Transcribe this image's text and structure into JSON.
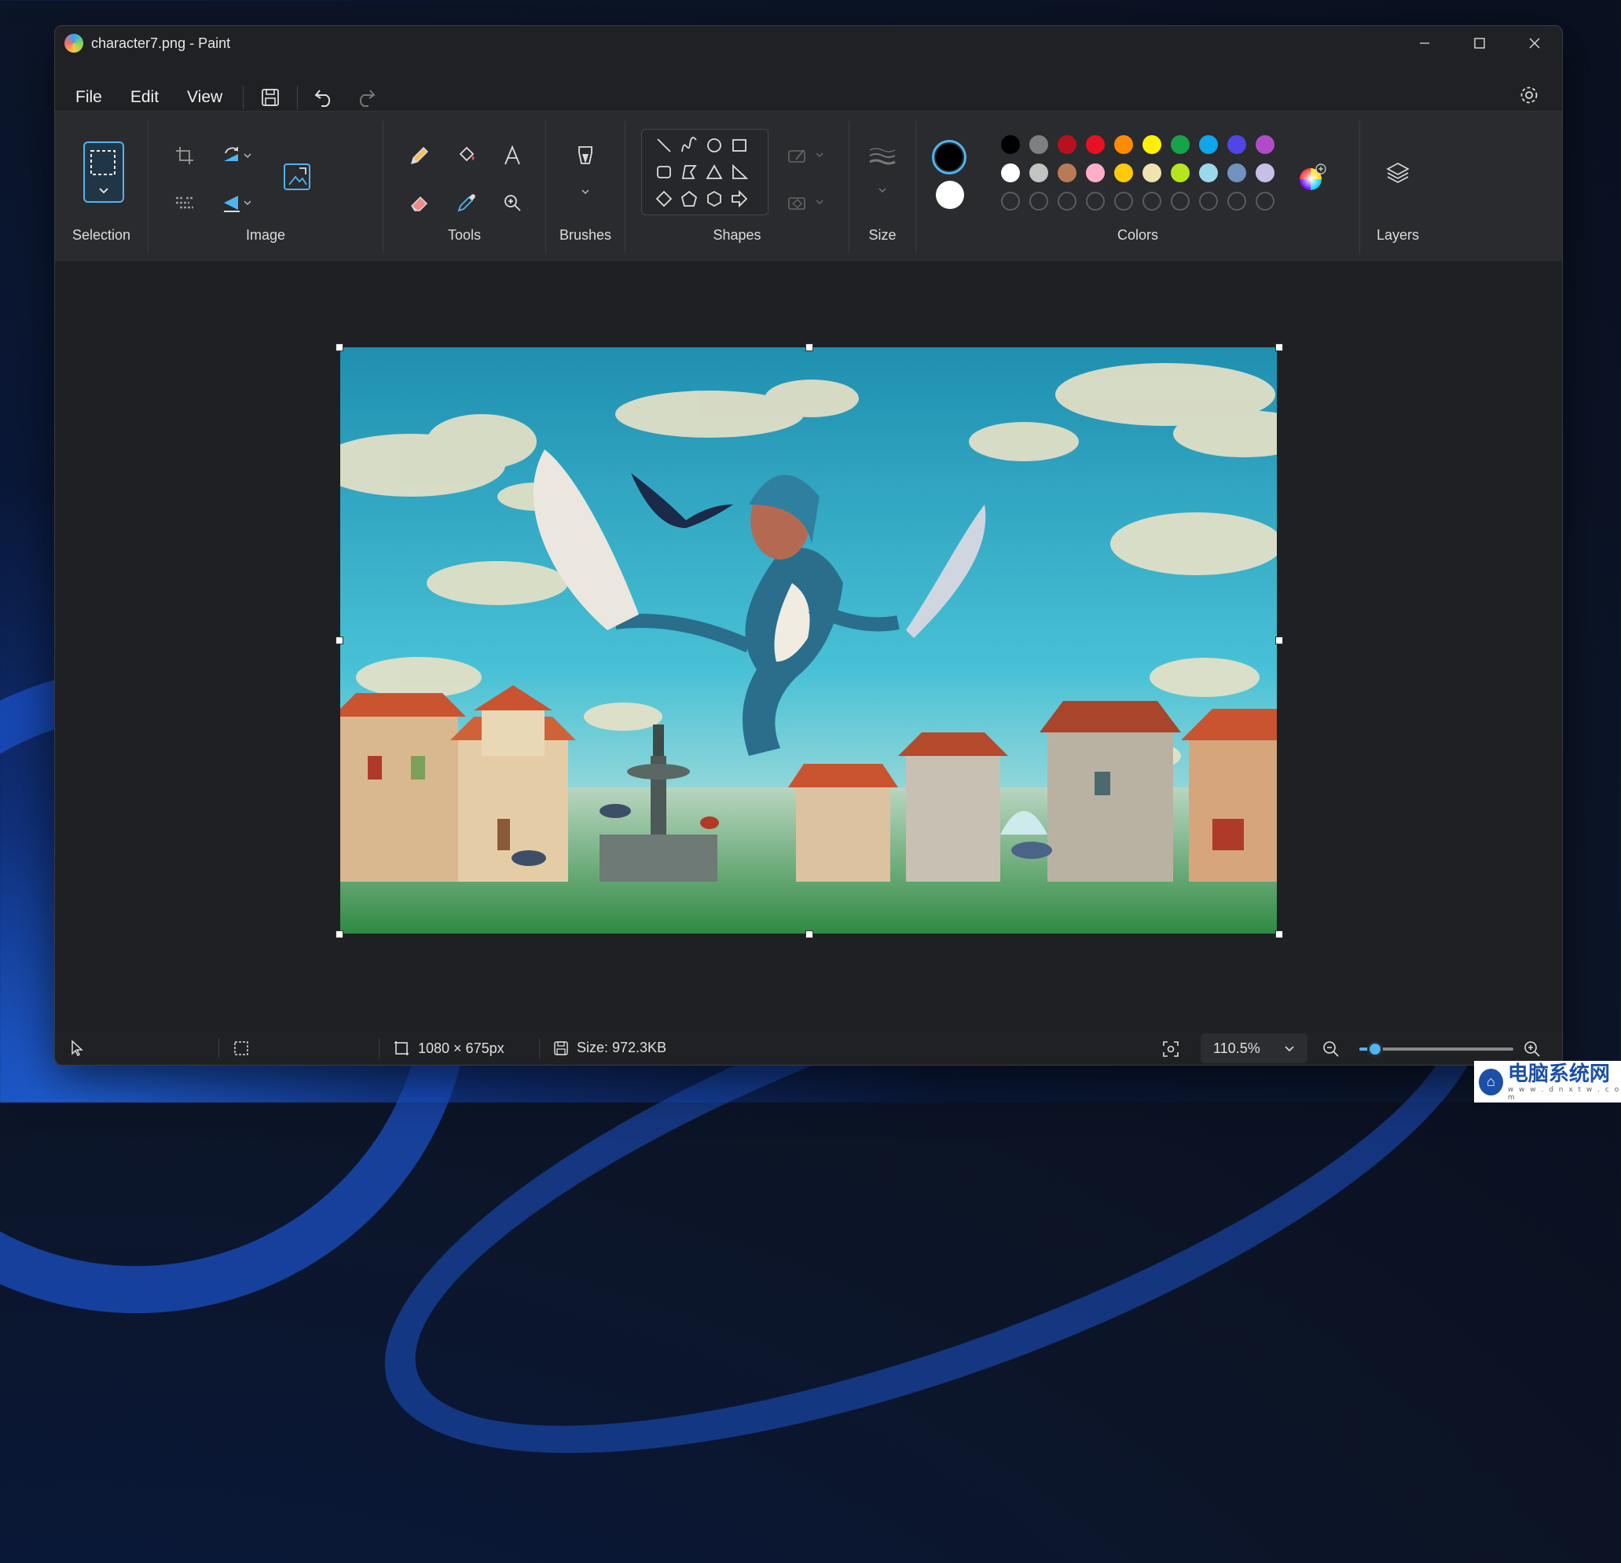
{
  "window": {
    "title": "character7.png - Paint"
  },
  "menu": {
    "file": "File",
    "edit": "Edit",
    "view": "View"
  },
  "ribbon": {
    "groups": {
      "selection": "Selection",
      "image": "Image",
      "tools": "Tools",
      "brushes": "Brushes",
      "shapes": "Shapes",
      "size": "Size",
      "colors": "Colors",
      "layers": "Layers"
    },
    "primary_color": "#000000",
    "secondary_color": "#ffffff",
    "palette_row1": [
      "#000000",
      "#7f7f7f",
      "#b5121b",
      "#e81123",
      "#ff8c00",
      "#fff100",
      "#16a34a",
      "#0ea5e9",
      "#4f46e5",
      "#b04cc8"
    ],
    "palette_row2": [
      "#ffffff",
      "#c3c3c3",
      "#b97a57",
      "#ffaec9",
      "#ffc90e",
      "#efe4b0",
      "#b5e61d",
      "#99d9ea",
      "#7092be",
      "#c8bfe7"
    ]
  },
  "status": {
    "dimensions": "1080 × 675px",
    "size": "Size: 972.3KB",
    "zoom": "110.5%",
    "zoom_slider_fraction": 0.1
  },
  "watermark": {
    "text": "电脑系统网",
    "url": "w w w . d n x t w . c o m"
  }
}
